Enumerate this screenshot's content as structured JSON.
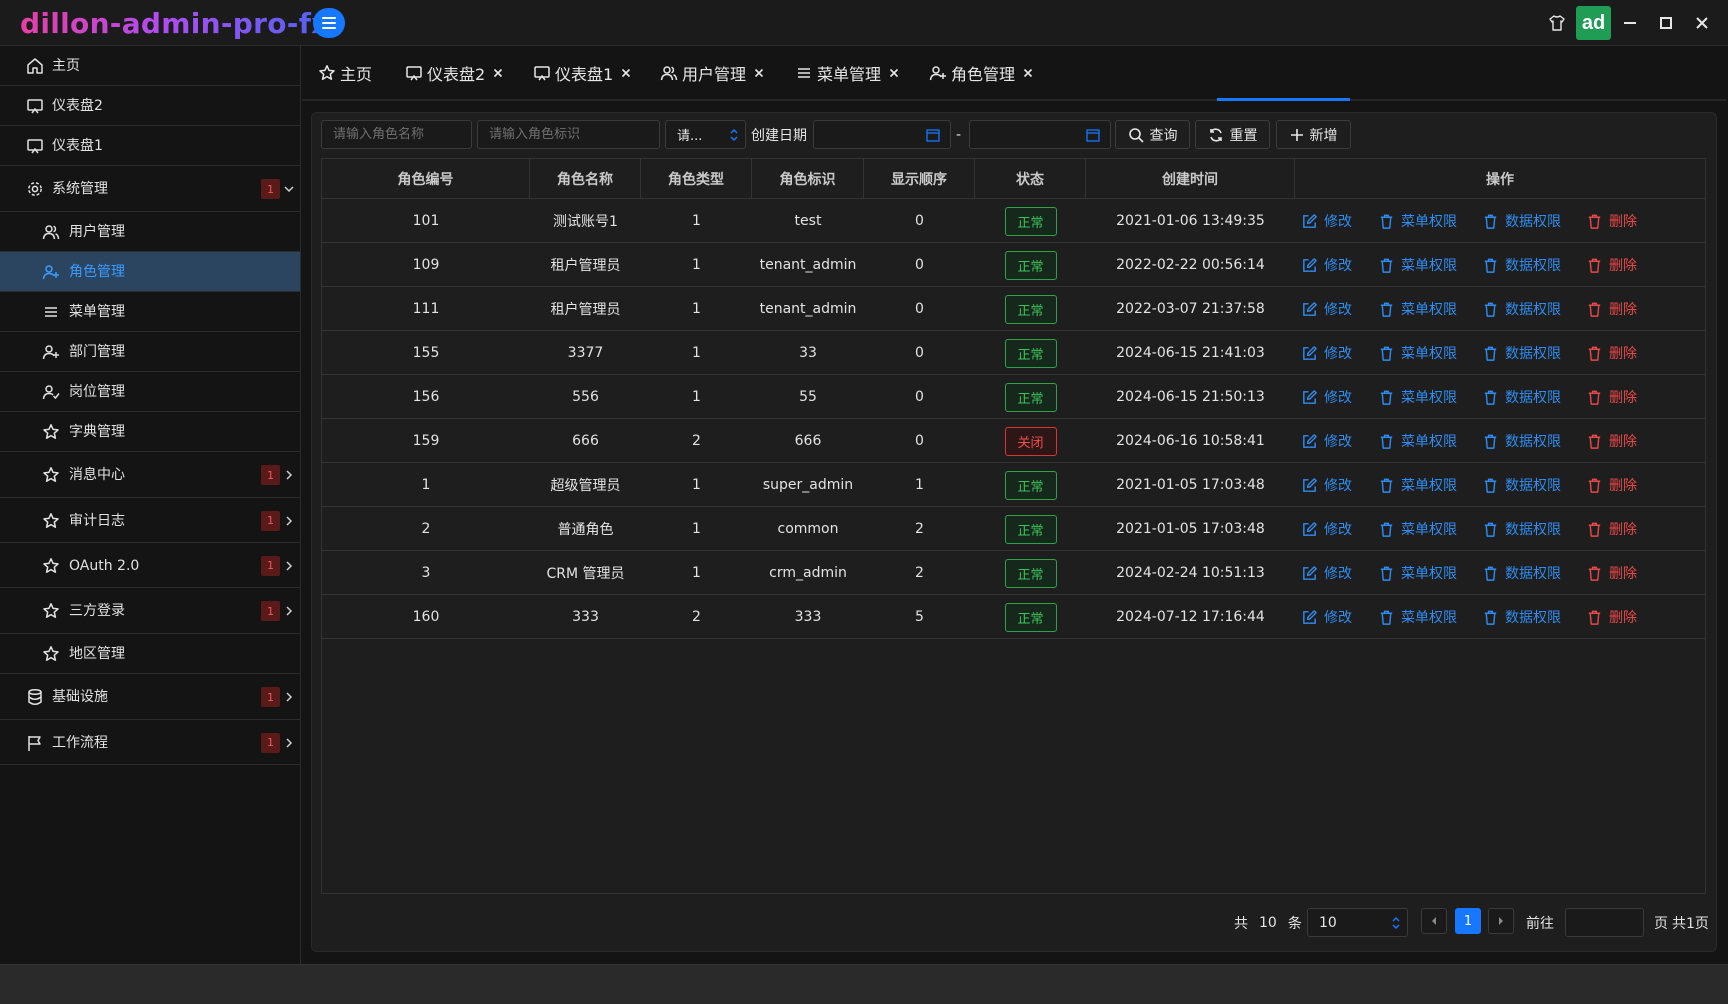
{
  "app": {
    "title": "dillon-admin-pro-fx",
    "avatar": "ad"
  },
  "colors": {
    "accent": "#1677ff",
    "success": "#3bc45a",
    "danger": "#e84848",
    "link": "#2f8cf0",
    "badge": "#5a1a1a"
  },
  "sidebar": {
    "items": [
      {
        "label": "主页",
        "icon": "home-icon"
      },
      {
        "label": "仪表盘2",
        "icon": "monitor-icon"
      },
      {
        "label": "仪表盘1",
        "icon": "monitor-icon"
      },
      {
        "label": "系统管理",
        "icon": "gear-icon",
        "badge": "1",
        "expanded": true
      },
      {
        "label": "用户管理",
        "icon": "users-icon"
      },
      {
        "label": "角色管理",
        "icon": "user-plus-icon",
        "active": true
      },
      {
        "label": "菜单管理",
        "icon": "menu-icon"
      },
      {
        "label": "部门管理",
        "icon": "user-plus-icon"
      },
      {
        "label": "岗位管理",
        "icon": "user-check-icon"
      },
      {
        "label": "字典管理",
        "icon": "star-icon"
      },
      {
        "label": "消息中心",
        "icon": "star-icon",
        "badge": "1"
      },
      {
        "label": "审计日志",
        "icon": "star-icon",
        "badge": "1"
      },
      {
        "label": "OAuth 2.0",
        "icon": "star-icon",
        "badge": "1"
      },
      {
        "label": "三方登录",
        "icon": "star-icon",
        "badge": "1"
      },
      {
        "label": "地区管理",
        "icon": "star-icon"
      },
      {
        "label": "基础设施",
        "icon": "database-icon",
        "badge": "1"
      },
      {
        "label": "工作流程",
        "icon": "flag-icon",
        "badge": "1"
      }
    ]
  },
  "tabs": [
    {
      "label": "主页",
      "icon": "star-icon"
    },
    {
      "label": "仪表盘2",
      "icon": "monitor-icon"
    },
    {
      "label": "仪表盘1",
      "icon": "monitor-icon"
    },
    {
      "label": "用户管理",
      "icon": "users-icon"
    },
    {
      "label": "菜单管理",
      "icon": "menu-icon"
    },
    {
      "label": "角色管理",
      "icon": "user-plus-icon",
      "active": true
    }
  ],
  "filters": {
    "role_name_placeholder": "请输入角色名称",
    "role_key_placeholder": "请输入角色标识",
    "status_select": "请...",
    "date_label": "创建日期",
    "date_separator": "-",
    "search_label": "查询",
    "reset_label": "重置",
    "add_label": "新增"
  },
  "table": {
    "columns": [
      "角色编号",
      "角色名称",
      "角色类型",
      "角色标识",
      "显示顺序",
      "状态",
      "创建时间",
      "操作"
    ],
    "actions": {
      "edit": "修改",
      "menu_perm": "菜单权限",
      "data_perm": "数据权限",
      "delete": "删除"
    },
    "rows": [
      {
        "id": "101",
        "name": "测试账号1",
        "type": "1",
        "key": "test",
        "sort": "0",
        "status": "正常",
        "status_ok": true,
        "created": "2021-01-06 13:49:35"
      },
      {
        "id": "109",
        "name": "租户管理员",
        "type": "1",
        "key": "tenant_admin",
        "sort": "0",
        "status": "正常",
        "status_ok": true,
        "created": "2022-02-22 00:56:14"
      },
      {
        "id": "111",
        "name": "租户管理员",
        "type": "1",
        "key": "tenant_admin",
        "sort": "0",
        "status": "正常",
        "status_ok": true,
        "created": "2022-03-07 21:37:58"
      },
      {
        "id": "155",
        "name": "3377",
        "type": "1",
        "key": "33",
        "sort": "0",
        "status": "正常",
        "status_ok": true,
        "created": "2024-06-15 21:41:03"
      },
      {
        "id": "156",
        "name": "556",
        "type": "1",
        "key": "55",
        "sort": "0",
        "status": "正常",
        "status_ok": true,
        "created": "2024-06-15 21:50:13"
      },
      {
        "id": "159",
        "name": "666",
        "type": "2",
        "key": "666",
        "sort": "0",
        "status": "关闭",
        "status_ok": false,
        "created": "2024-06-16 10:58:41"
      },
      {
        "id": "1",
        "name": "超级管理员",
        "type": "1",
        "key": "super_admin",
        "sort": "1",
        "status": "正常",
        "status_ok": true,
        "created": "2021-01-05 17:03:48"
      },
      {
        "id": "2",
        "name": "普通角色",
        "type": "1",
        "key": "common",
        "sort": "2",
        "status": "正常",
        "status_ok": true,
        "created": "2021-01-05 17:03:48"
      },
      {
        "id": "3",
        "name": "CRM 管理员",
        "type": "1",
        "key": "crm_admin",
        "sort": "2",
        "status": "正常",
        "status_ok": true,
        "created": "2024-02-24 10:51:13"
      },
      {
        "id": "160",
        "name": "333",
        "type": "2",
        "key": "333",
        "sort": "5",
        "status": "正常",
        "status_ok": true,
        "created": "2024-07-12 17:16:44"
      }
    ]
  },
  "pagination": {
    "total_prefix": "共",
    "total": "10",
    "total_suffix": "条",
    "page_size": "10",
    "current_page": "1",
    "goto_label": "前往",
    "page_suffix": "页",
    "pages_total": "共1页"
  }
}
